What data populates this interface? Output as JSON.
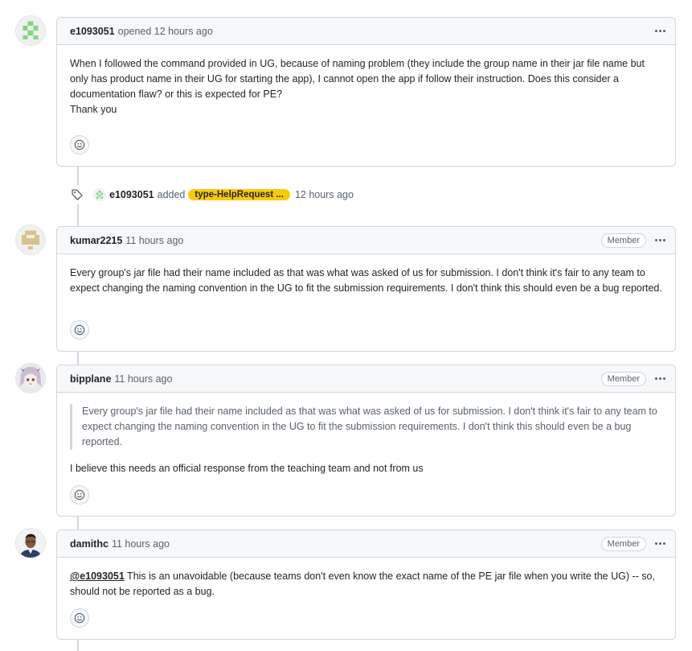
{
  "comments": [
    {
      "author": "e1093051",
      "meta": "opened 12 hours ago",
      "body": [
        "When I followed the command provided in UG, because of naming problem (they include the group name in their jar file name but only has product name in their UG for starting the app), I cannot open the app if follow their instruction. Does this consider a documentation flaw? or this is expected for PE?",
        "Thank you"
      ],
      "avatar_icon": "identicon-green"
    },
    {
      "author": "kumar2215",
      "meta": "11 hours ago",
      "badge": "Member",
      "body": [
        "Every group's jar file had their name included as that was what was asked of us for submission. I don't think it's fair to any team to expect changing the naming convention in the UG to fit the submission requirements. I don't think this should even be a bug reported."
      ],
      "avatar_icon": "identicon-tan"
    },
    {
      "author": "bipplane",
      "meta": "11 hours ago",
      "badge": "Member",
      "quote": "Every group's jar file had their name included as that was what was asked of us for submission. I don't think it's fair to any team to expect changing the naming convention in the UG to fit the submission requirements. I don't think this should even be a bug reported.",
      "body": [
        "I believe this needs an official response from the teaching team and not from us"
      ],
      "avatar_icon": "anime-avatar"
    },
    {
      "author": "damithc",
      "meta": "11 hours ago",
      "badge": "Member",
      "mention": "@e1093051",
      "body_after_mention": " This is an unavoidable (because teams don't even know the exact name of the PE jar file when you write the UG) -- so, should not be reported as a bug.",
      "avatar_icon": "photo-avatar"
    }
  ],
  "event": {
    "author": "e1093051",
    "action": "added",
    "label": "type-HelpRequest ...",
    "label_color": "#fbca04",
    "time": "12 hours ago",
    "icon": "tag-icon"
  },
  "icons": {
    "reaction": "smiley-icon",
    "menu": "kebab-icon"
  }
}
